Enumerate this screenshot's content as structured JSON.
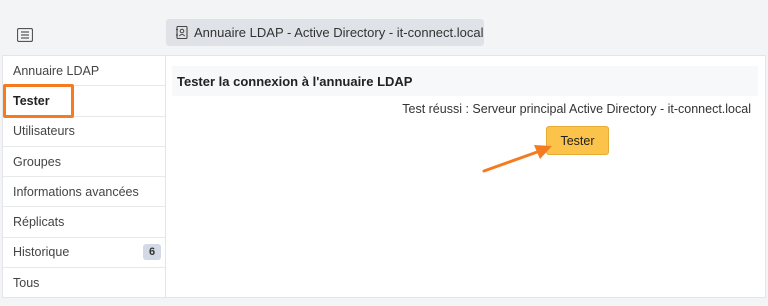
{
  "header": {
    "title": "Annuaire LDAP - Active Directory - it-connect.local"
  },
  "sidebar": {
    "items": [
      {
        "label": "Annuaire LDAP"
      },
      {
        "label": "Tester"
      },
      {
        "label": "Utilisateurs"
      },
      {
        "label": "Groupes"
      },
      {
        "label": "Informations avancées"
      },
      {
        "label": "Réplicats"
      },
      {
        "label": "Historique",
        "badge": "6"
      },
      {
        "label": "Tous"
      }
    ]
  },
  "main": {
    "title": "Tester la connexion à l'annuaire LDAP",
    "result": "Test réussi : Serveur principal Active Directory - it-connect.local",
    "test_button": "Tester"
  },
  "colors": {
    "accent_orange": "#f47b20",
    "button_yellow": "#fbc34a"
  },
  "icons": {
    "top_left": "list-icon",
    "tab": "address-book-icon",
    "annotation": "arrow-icon"
  }
}
